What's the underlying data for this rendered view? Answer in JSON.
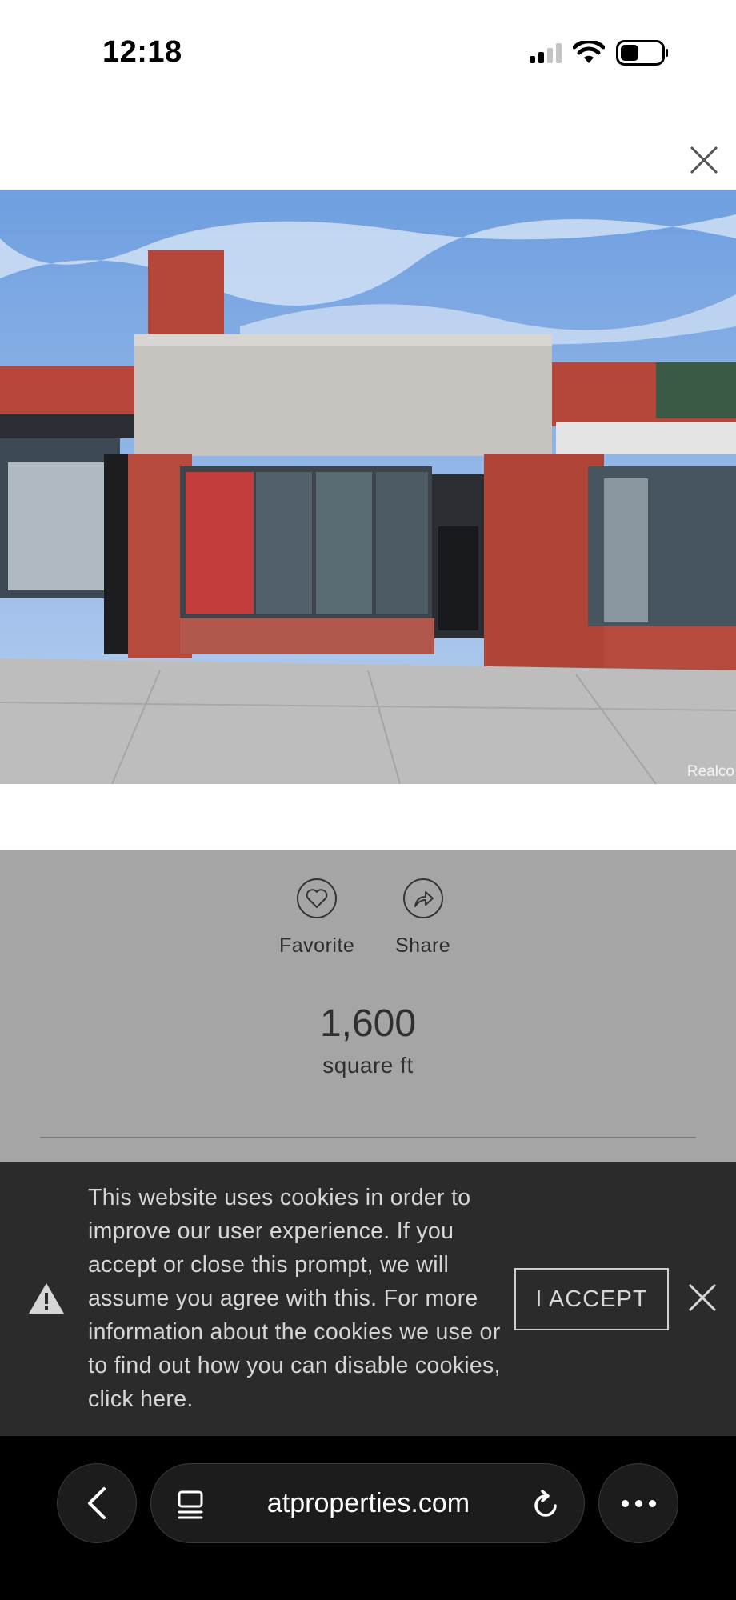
{
  "status_bar": {
    "time": "12:18"
  },
  "photo": {
    "watermark": "Realco"
  },
  "actions": {
    "favorite_label": "Favorite",
    "share_label": "Share"
  },
  "listing": {
    "square_feet": "1,600",
    "square_feet_unit": "square ft"
  },
  "cookie_banner": {
    "message": "This website uses cookies in order to improve our user experience. If you accept or close this prompt, we will assume you agree with this. For more information about the cookies we use or to find out how you can disable cookies, click here.",
    "accept_label": "I ACCEPT"
  },
  "browser": {
    "url": "atproperties.com"
  },
  "colors": {
    "overlay_gray": "#a5a5a5",
    "banner_bg": "#2b2b2b",
    "browser_bg": "#000000"
  }
}
